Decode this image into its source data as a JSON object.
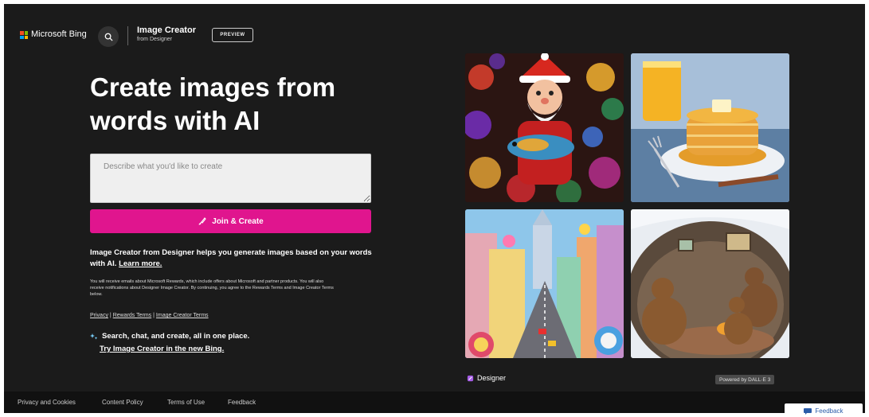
{
  "header": {
    "brand": "Microsoft Bing",
    "title": "Image Creator",
    "subtitle": "from Designer",
    "badge": "PREVIEW",
    "icons": [
      "windows-logo",
      "search-icon"
    ]
  },
  "hero": {
    "title": "Create images from words with AI",
    "prompt_placeholder": "Describe what you'd like to create",
    "prompt_value": "",
    "join_label": "Join & Create",
    "description": "Image Creator from Designer helps you generate images based on your words with AI.",
    "learn_more": "Learn more.",
    "fine_print": "You will receive emails about Microsoft Rewards, which include offers about Microsoft and partner products. You will also receive notifications about Designer Image Creator. By continuing, you agree to the Rewards Terms and Image Creator Terms below.",
    "terms": {
      "privacy": "Privacy",
      "rewards": "Rewards Terms",
      "image_creator": "Image Creator Terms",
      "separator": "|"
    },
    "promo_line": "Search, chat, and create, all in one place.",
    "promo_link": "Try Image Creator in the new Bing."
  },
  "gallery": {
    "images": [
      "santa-with-fish-ornaments",
      "pancakes-breakfast",
      "candy-city-street",
      "bears-in-cozy-cave"
    ],
    "designer_label": "Designer",
    "powered_by": "Powered by DALL·E 3"
  },
  "footer": {
    "links": [
      "Privacy and Cookies",
      "Content Policy",
      "Terms of Use",
      "Feedback"
    ],
    "feedback_button": "Feedback"
  },
  "colors": {
    "background": "#1b1b1b",
    "accent": "#e0158e",
    "footer": "#111111"
  }
}
